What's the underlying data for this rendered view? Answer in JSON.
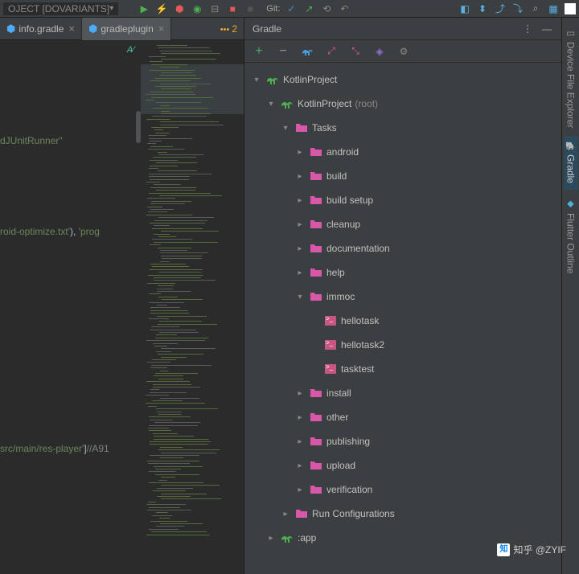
{
  "toolbar": {
    "dropdown": "OJECT [DOVARIANTS]",
    "git_label": "Git:"
  },
  "tabs": [
    {
      "label": "info.gradle",
      "active": false
    },
    {
      "label": "gradleplugin",
      "active": true
    }
  ],
  "tab_extra_count": "2",
  "code_lines": {
    "l1": "dJUnitRunner\"",
    "l2_a": "roid-optimize.txt'",
    "l2_b": "), ",
    "l2_c": "'prog",
    "l3_a": "src/main/res-player'",
    "l3_b": "]",
    "l3_c": "//A91"
  },
  "panel": {
    "title": "Gradle"
  },
  "sidetabs": {
    "device": "Device File Explorer",
    "gradle": "Gradle",
    "flutter": "Flutter Outline"
  },
  "tree": {
    "root": "KotlinProject",
    "items": [
      {
        "level": 0,
        "exp": true,
        "icon": "elephant",
        "label": "KotlinProject",
        "suffix": ""
      },
      {
        "level": 1,
        "exp": true,
        "icon": "elephant",
        "label": "KotlinProject",
        "suffix": " (root)"
      },
      {
        "level": 2,
        "exp": true,
        "icon": "folder",
        "label": "Tasks"
      },
      {
        "level": 3,
        "exp": false,
        "icon": "folder",
        "label": "android"
      },
      {
        "level": 3,
        "exp": false,
        "icon": "folder",
        "label": "build"
      },
      {
        "level": 3,
        "exp": false,
        "icon": "folder",
        "label": "build setup"
      },
      {
        "level": 3,
        "exp": false,
        "icon": "folder",
        "label": "cleanup"
      },
      {
        "level": 3,
        "exp": false,
        "icon": "folder",
        "label": "documentation"
      },
      {
        "level": 3,
        "exp": false,
        "icon": "folder",
        "label": "help"
      },
      {
        "level": 3,
        "exp": true,
        "icon": "folder",
        "label": "immoc"
      },
      {
        "level": 4,
        "exp": null,
        "icon": "task",
        "label": "hellotask"
      },
      {
        "level": 4,
        "exp": null,
        "icon": "task",
        "label": "hellotask2"
      },
      {
        "level": 4,
        "exp": null,
        "icon": "task",
        "label": "tasktest"
      },
      {
        "level": 3,
        "exp": false,
        "icon": "folder",
        "label": "install"
      },
      {
        "level": 3,
        "exp": false,
        "icon": "folder",
        "label": "other"
      },
      {
        "level": 3,
        "exp": false,
        "icon": "folder",
        "label": "publishing"
      },
      {
        "level": 3,
        "exp": false,
        "icon": "folder",
        "label": "upload"
      },
      {
        "level": 3,
        "exp": false,
        "icon": "folder",
        "label": "verification"
      },
      {
        "level": 2,
        "exp": false,
        "icon": "folder",
        "label": "Run Configurations"
      },
      {
        "level": 1,
        "exp": false,
        "icon": "elephant",
        "label": ":app"
      }
    ]
  },
  "watermark": "知乎 @ZYIF"
}
